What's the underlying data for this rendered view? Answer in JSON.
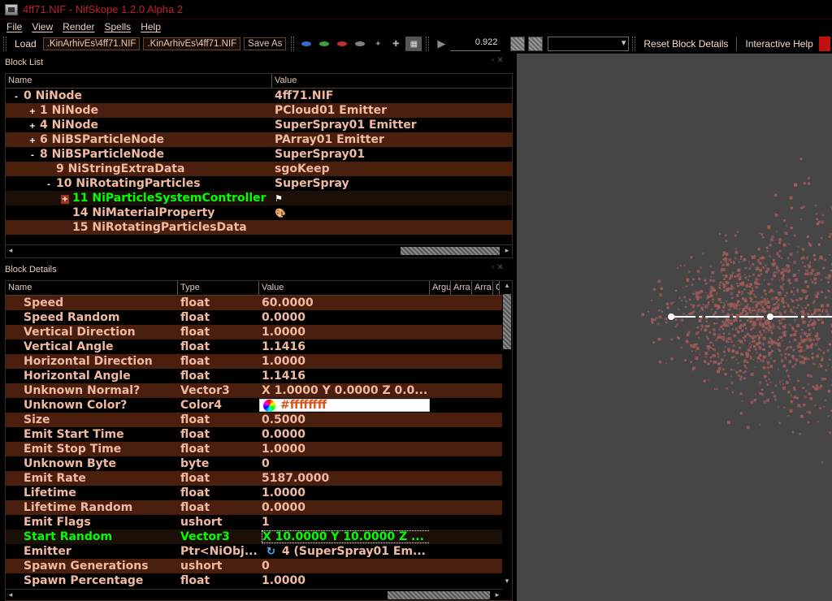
{
  "window": {
    "title": "4ff71.NIF - NifSkope 1.2.0 Alpha 2"
  },
  "menu": {
    "file": "File",
    "view": "View",
    "render": "Render",
    "spells": "Spells",
    "help": "Help"
  },
  "toolbar": {
    "load": "Load",
    "load_path": ".KinArhivEs\\4ff71.NIF",
    "save_path": ".KinArhivEs\\4ff71.NIF",
    "save_as": "Save As",
    "anim_time": "0.922",
    "reset_block": "Reset Block Details",
    "interactive_help": "Interactive Help"
  },
  "block_list": {
    "title": "Block List",
    "col_name": "Name",
    "col_value": "Value",
    "rows": [
      {
        "exp": "-",
        "name": "0 NiNode",
        "value": "4ff71.NIF"
      },
      {
        "exp": "+",
        "name": "1 NiNode",
        "value": "PCloud01 Emitter"
      },
      {
        "exp": "+",
        "name": "4 NiNode",
        "value": "SuperSpray01 Emitter"
      },
      {
        "exp": "+",
        "name": "6 NiBSParticleNode",
        "value": "PArray01 Emitter"
      },
      {
        "exp": "-",
        "name": "8 NiBSParticleNode",
        "value": "SuperSpray01"
      },
      {
        "exp": "",
        "name": "9 NiStringExtraData",
        "value": "sgoKeep"
      },
      {
        "exp": "-",
        "name": "10 NiRotatingParticles",
        "value": "SuperSpray"
      },
      {
        "exp": "+",
        "name": "11 NiParticleSystemController",
        "value": ""
      },
      {
        "exp": "",
        "name": "14 NiMaterialProperty",
        "value": ""
      },
      {
        "exp": "",
        "name": "15 NiRotatingParticlesData",
        "value": ""
      }
    ]
  },
  "block_details": {
    "title": "Block Details",
    "col_name": "Name",
    "col_type": "Type",
    "col_value": "Value",
    "col_arg": "Argu",
    "col_arr1": "Arra",
    "col_arr2": "Arra",
    "col_cond": "C",
    "rows": [
      {
        "name": "Speed",
        "type": "float",
        "value": "60.0000"
      },
      {
        "name": "Speed Random",
        "type": "float",
        "value": "0.0000"
      },
      {
        "name": "Vertical Direction",
        "type": "float",
        "value": "1.0000"
      },
      {
        "name": "Vertical Angle",
        "type": "float",
        "value": "1.1416"
      },
      {
        "name": "Horizontal Direction",
        "type": "float",
        "value": "1.0000"
      },
      {
        "name": "Horizontal Angle",
        "type": "float",
        "value": "1.1416"
      },
      {
        "name": "Unknown Normal?",
        "type": "Vector3",
        "value": "X 1.0000 Y 0.0000 Z 0.0..."
      },
      {
        "name": "Unknown Color?",
        "type": "Color4",
        "value": "#ffffffff"
      },
      {
        "name": "Size",
        "type": "float",
        "value": "0.5000"
      },
      {
        "name": "Emit Start Time",
        "type": "float",
        "value": "0.0000"
      },
      {
        "name": "Emit Stop Time",
        "type": "float",
        "value": "1.0000"
      },
      {
        "name": "Unknown Byte",
        "type": "byte",
        "value": "0"
      },
      {
        "name": "Emit Rate",
        "type": "float",
        "value": "5187.0000"
      },
      {
        "name": "Lifetime",
        "type": "float",
        "value": "1.0000"
      },
      {
        "name": "Lifetime Random",
        "type": "float",
        "value": "0.0000"
      },
      {
        "name": "Emit Flags",
        "type": "ushort",
        "value": "1"
      },
      {
        "name": "Start Random",
        "type": "Vector3",
        "value": "X 10.0000 Y 10.0000 Z ..."
      },
      {
        "name": "Emitter",
        "type": "Ptr<NiObj...",
        "value": "4 (SuperSpray01 Em..."
      },
      {
        "name": "Spawn Generations",
        "type": "ushort",
        "value": "0"
      },
      {
        "name": "Spawn Percentage",
        "type": "float",
        "value": "1.0000"
      }
    ]
  },
  "colors": {
    "accent": "#c0202a",
    "row_alt": "#4a1f0e",
    "selected": "#00ff00",
    "particle": "#9e5a58",
    "viewport_bg": "#464646"
  }
}
